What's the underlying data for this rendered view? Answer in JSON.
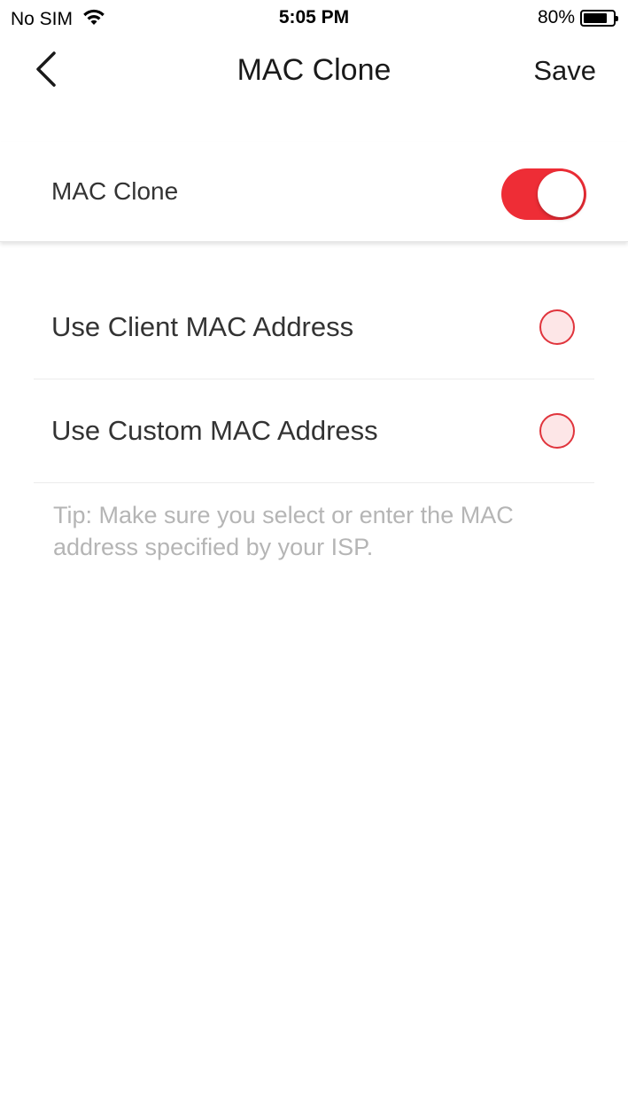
{
  "status_bar": {
    "carrier": "No SIM",
    "time": "5:05 PM",
    "battery_percent": "80%",
    "battery_level": 0.8,
    "wifi_icon": "wifi-icon"
  },
  "nav": {
    "title": "MAC Clone",
    "save_label": "Save",
    "back_icon": "chevron-left-icon"
  },
  "mac_clone": {
    "label": "MAC Clone",
    "enabled": true,
    "accent_color": "#ee2d36"
  },
  "options": [
    {
      "label": "Use Client MAC Address",
      "selected": false
    },
    {
      "label": "Use Custom MAC Address",
      "selected": false
    }
  ],
  "tip": "Tip: Make sure you select or enter the MAC address specified by your ISP."
}
